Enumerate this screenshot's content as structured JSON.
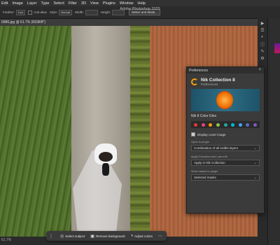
{
  "menubar": {
    "items": [
      "Edit",
      "Image",
      "Layer",
      "Type",
      "Select",
      "Filter",
      "3D",
      "View",
      "Plugins",
      "Window",
      "Help"
    ]
  },
  "app_title": "Adobe Photoshop 2025",
  "options": {
    "feather_label": "Feather:",
    "feather_value": "0 px",
    "antialias_label": "Anti-alias",
    "style_label": "Style:",
    "style_value": "Normal",
    "width_label": "Width:",
    "height_label": "Height:",
    "select_mask_label": "Select and Mask..."
  },
  "document": {
    "tab_label": "0986.jpg @ 61.7% (RGB/8*)",
    "zoom": "61.7%"
  },
  "taskbar": {
    "items": [
      "Select subject",
      "Remove background",
      "Adjust colors"
    ]
  },
  "panel": {
    "title": "Preferences",
    "product_name": "Nik Collection 8",
    "subtitle": "Preferences",
    "plugin_name": "Nik 8 Color Efex",
    "swatch_colors": [
      "#e53935",
      "#ec407a",
      "#ff9800",
      "#8bc34a",
      "#26a69a",
      "#00bcd4",
      "#42a5f5",
      "#5c6bc0",
      "#7e57c2"
    ],
    "display_cover_label": "Display cover image",
    "open_in_plugin_label": "Open in plugin",
    "open_in_plugin_value": "Combination of all visible layers",
    "apply_label": "Apply Favorites and Last edit",
    "apply_value": "Apply in Nik Collection",
    "send_masks_label": "Send masks to plugin",
    "send_masks_value": "Selected masks"
  },
  "colors": {
    "accent": "#f2a20a"
  }
}
